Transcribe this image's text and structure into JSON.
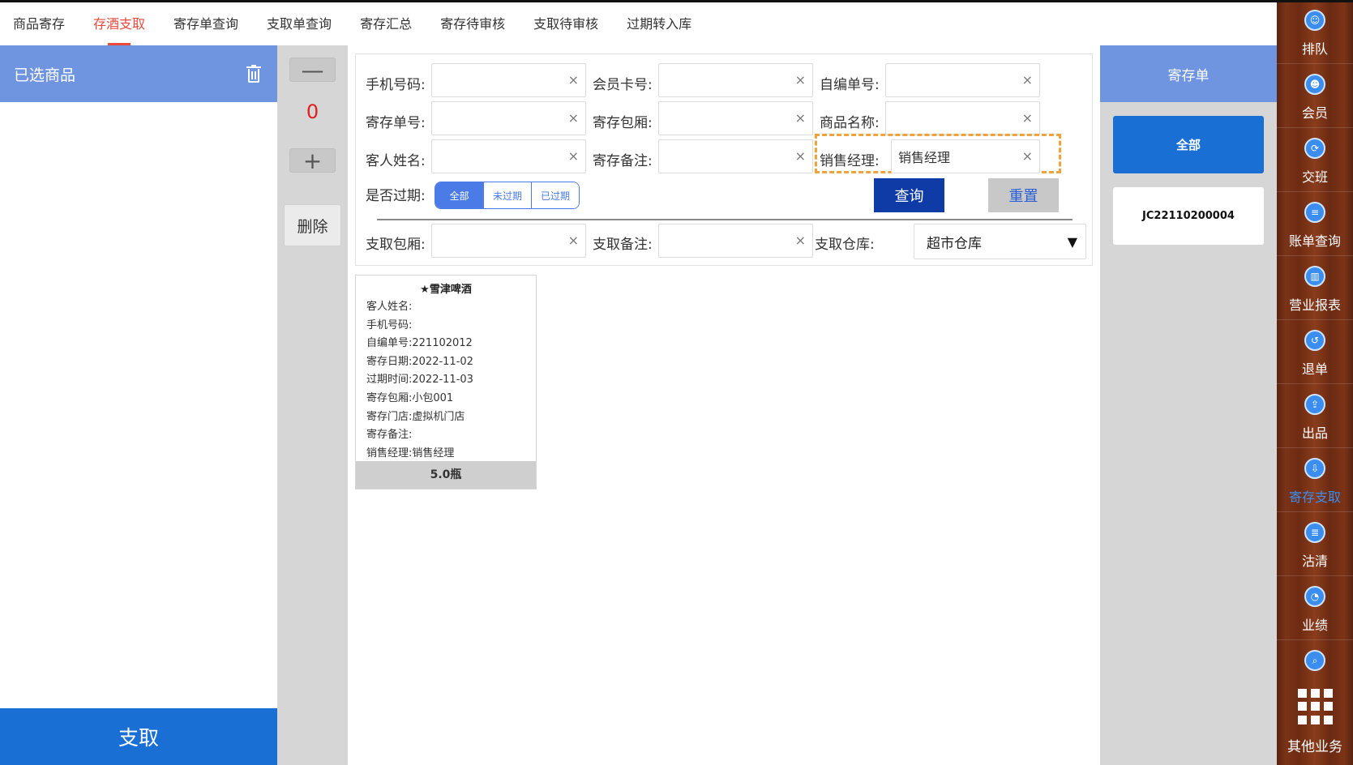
{
  "tabs": [
    "商品寄存",
    "存酒支取",
    "寄存单查询",
    "支取单查询",
    "寄存汇总",
    "寄存待审核",
    "支取待审核",
    "过期转入库"
  ],
  "active_tab": "存酒支取",
  "left": {
    "title": "已选商品",
    "pay_label": "支取"
  },
  "stepper": {
    "minus": "—",
    "qty": "0",
    "plus": "+",
    "delete_label": "删除"
  },
  "form": {
    "phone_label": "手机号码:",
    "member_label": "会员卡号:",
    "selfno_label": "自编单号:",
    "orderno_label": "寄存单号:",
    "room_label": "寄存包厢:",
    "goods_label": "商品名称:",
    "guest_label": "客人姓名:",
    "remark_label": "寄存备注:",
    "manager_label": "销售经理:",
    "manager_value": "销售经理",
    "expired_label": "是否过期:",
    "expired_options": [
      "全部",
      "未过期",
      "已过期"
    ],
    "query_label": "查询",
    "reset_label": "重置",
    "take_room_label": "支取包厢:",
    "take_remark_label": "支取备注:",
    "warehouse_label": "支取仓库:",
    "warehouse_value": "超市仓库",
    "clear_icon": "×",
    "arrow_icon": "▼"
  },
  "card": {
    "name": "★雪津啤酒",
    "rows": [
      "客人姓名:",
      "手机号码:",
      "自编单号:221102012",
      "寄存日期:2022-11-02",
      "过期时间:2022-11-03",
      "寄存包厢:小包001",
      "寄存门店:虚拟机门店",
      "寄存备注:",
      "销售经理:销售经理"
    ],
    "qty": "5.0瓶"
  },
  "right": {
    "title": "寄存单",
    "all_label": "全部",
    "orders": [
      "JC22110200004"
    ]
  },
  "sidebar": {
    "items": [
      {
        "label": "排队",
        "icon": "queue-icon",
        "glyph": "☺"
      },
      {
        "label": "会员",
        "icon": "member-icon",
        "glyph": "☻"
      },
      {
        "label": "交班",
        "icon": "shift-icon",
        "glyph": "⟳"
      },
      {
        "label": "账单查询",
        "icon": "bill-icon",
        "glyph": "≡"
      },
      {
        "label": "营业报表",
        "icon": "report-icon",
        "glyph": "▥"
      },
      {
        "label": "退单",
        "icon": "refund-icon",
        "glyph": "↺"
      },
      {
        "label": "出品",
        "icon": "output-icon",
        "glyph": "⇪"
      },
      {
        "label": "寄存支取",
        "icon": "deposit-icon",
        "glyph": "⇩"
      },
      {
        "label": "沽清",
        "icon": "clear-stock-icon",
        "glyph": "≣"
      },
      {
        "label": "业绩",
        "icon": "performance-icon",
        "glyph": "◔"
      },
      {
        "label": "",
        "icon": "search-icon",
        "glyph": "⌕"
      }
    ],
    "active": "寄存支取",
    "other_label": "其他业务"
  }
}
